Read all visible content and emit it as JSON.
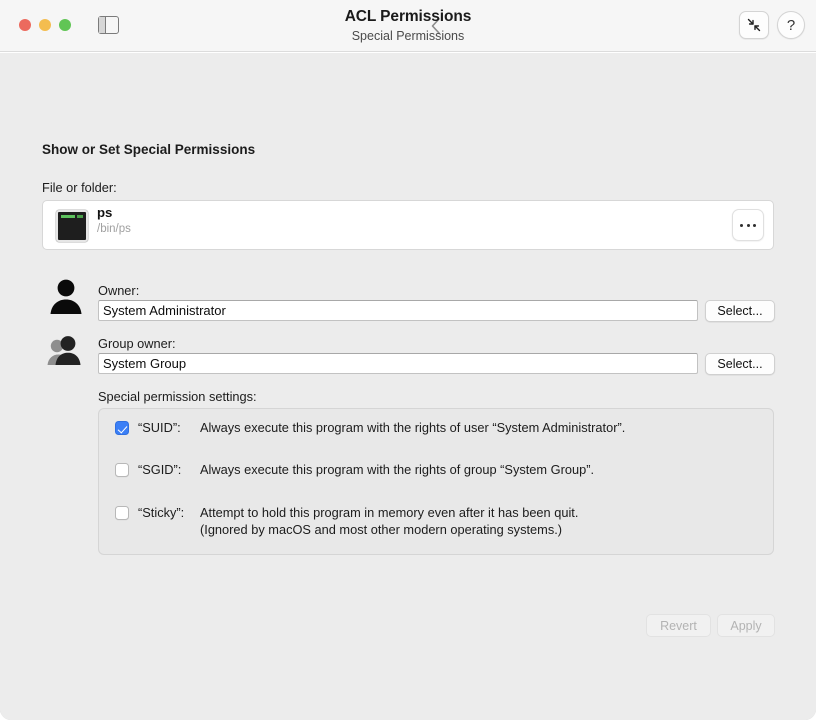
{
  "window": {
    "traffic_lights": [
      "close",
      "minimize",
      "maximize"
    ],
    "colors": {
      "close": "#ec6a5e",
      "minimize": "#f4bd4f",
      "maximize": "#61c555",
      "accent": "#3b7ff6",
      "window_bg": "#ececec",
      "titlebar_bg": "#f6f6f6"
    }
  },
  "titlebar": {
    "sidebar_toggle_icon": "sidebar-toggle-icon",
    "back_icon": "chevron-left-icon",
    "title": "ACL Permissions",
    "subtitle": "Special Permissions",
    "collapse_icon": "collapse-arrows-icon",
    "help_label": "?"
  },
  "main": {
    "section_title": "Show or Set Special Permissions",
    "file_label": "File or folder:",
    "file": {
      "icon": "terminal-icon",
      "name": "ps",
      "path": "/bin/ps",
      "more_button": "…"
    },
    "owner": {
      "icon": "person-icon",
      "label": "Owner:",
      "value": "System Administrator",
      "placeholder": "",
      "select_label": "Select..."
    },
    "group_owner": {
      "icon": "people-icon",
      "label": "Group owner:",
      "value": "System Group",
      "placeholder": "",
      "select_label": "Select..."
    },
    "settings_label": "Special permission settings:",
    "permissions": [
      {
        "key": "“SUID”:",
        "checked": true,
        "description": "Always execute this program with the rights of user “System Administrator”.",
        "description_2": ""
      },
      {
        "key": "“SGID”:",
        "checked": false,
        "description": "Always execute this program with the rights of group “System Group”.",
        "description_2": ""
      },
      {
        "key": "“Sticky”:",
        "checked": false,
        "description": "Attempt to hold this program in memory even after it has been quit.",
        "description_2": "(Ignored by macOS and most other modern operating systems.)"
      }
    ],
    "footer": {
      "revert_label": "Revert",
      "apply_label": "Apply",
      "revert_enabled": false,
      "apply_enabled": false
    }
  }
}
